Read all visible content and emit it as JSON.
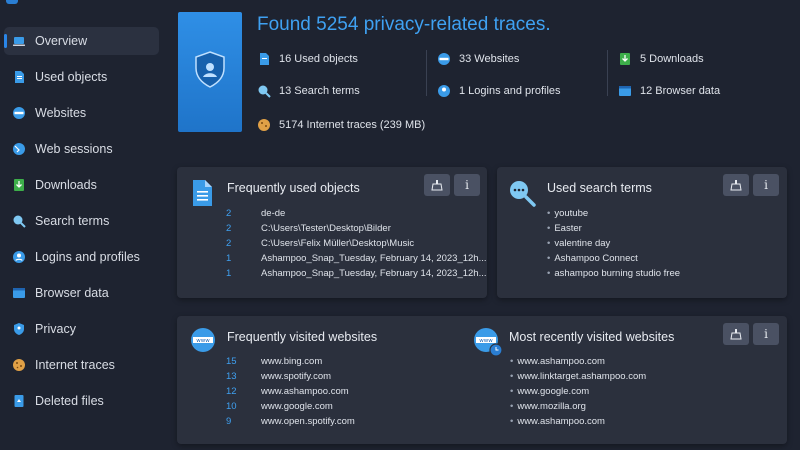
{
  "sidebar": {
    "items": [
      {
        "label": "Overview",
        "icon": "laptop-icon"
      },
      {
        "label": "Used objects",
        "icon": "file-icon"
      },
      {
        "label": "Websites",
        "icon": "www-icon"
      },
      {
        "label": "Web sessions",
        "icon": "globe-icon"
      },
      {
        "label": "Downloads",
        "icon": "download-icon"
      },
      {
        "label": "Search terms",
        "icon": "search-icon"
      },
      {
        "label": "Logins and profiles",
        "icon": "user-icon"
      },
      {
        "label": "Browser data",
        "icon": "browser-icon"
      },
      {
        "label": "Privacy",
        "icon": "shield-icon"
      },
      {
        "label": "Internet traces",
        "icon": "cookie-icon"
      },
      {
        "label": "Deleted files",
        "icon": "recycle-icon"
      }
    ]
  },
  "summary": {
    "title": "Found 5254 privacy-related traces.",
    "stats": {
      "used_objects": "16 Used objects",
      "websites": "33 Websites",
      "downloads": "5 Downloads",
      "search_terms": "13 Search terms",
      "logins": "1 Logins and profiles",
      "browser_data": "12 Browser data",
      "internet_traces": "5174 Internet traces  (239 MB)"
    }
  },
  "used_objects_card": {
    "title": "Frequently used objects",
    "rows": [
      {
        "count": "2",
        "text": "de-de"
      },
      {
        "count": "2",
        "text": "C:\\Users\\Tester\\Desktop\\Bilder"
      },
      {
        "count": "2",
        "text": "C:\\Users\\Felix Müller\\Desktop\\Music"
      },
      {
        "count": "1",
        "text": "Ashampoo_Snap_Tuesday, February 14, 2023_12h..."
      },
      {
        "count": "1",
        "text": "Ashampoo_Snap_Tuesday, February 14, 2023_12h..."
      }
    ]
  },
  "search_terms_card": {
    "title": "Used search terms",
    "rows": [
      "youtube",
      "Easter",
      "valentine day",
      "Ashampoo Connect",
      "ashampoo burning studio free"
    ]
  },
  "visited_card": {
    "title": "Frequently visited websites",
    "rows": [
      {
        "count": "15",
        "text": "www.bing.com"
      },
      {
        "count": "13",
        "text": "www.spotify.com"
      },
      {
        "count": "12",
        "text": "www.ashampoo.com"
      },
      {
        "count": "10",
        "text": "www.google.com"
      },
      {
        "count": "9",
        "text": "www.open.spotify.com"
      }
    ],
    "recent_title": "Most recently visited websites",
    "recent_rows": [
      "www.ashampoo.com",
      "www.linktarget.ashampoo.com",
      "www.google.com",
      "www.mozilla.org",
      "www.ashampoo.com"
    ]
  },
  "buttons": {
    "info_label": "i"
  },
  "colors": {
    "accent": "#3fa1f2",
    "background": "#1e2330",
    "card": "#2b303d",
    "button": "#4a5163"
  }
}
